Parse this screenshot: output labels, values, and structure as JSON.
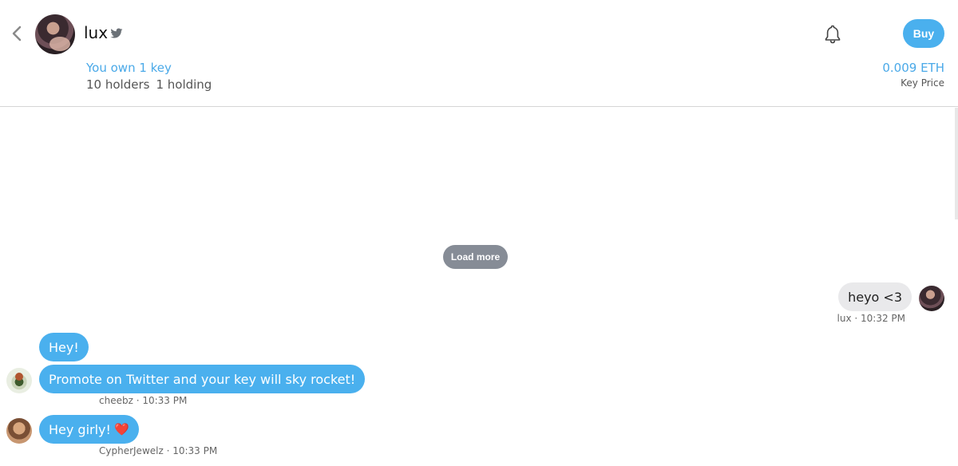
{
  "header": {
    "user_name": "lux",
    "own_key_text": "You own 1 key",
    "holders_text": "10 holders",
    "holding_text": "1 holding",
    "buy_label": "Buy",
    "price_value": "0.009 ETH",
    "price_label": "Key Price",
    "icons": [
      "back-chevron-icon",
      "twitter-bird-icon",
      "bell-icon"
    ]
  },
  "chat": {
    "load_more_label": "Load more",
    "messages": [
      {
        "text": "heyo <3",
        "direction": "outgoing",
        "meta": "lux · 10:32 PM"
      },
      {
        "text": "Hey!",
        "direction": "incoming"
      },
      {
        "text": "Promote on Twitter and your key will sky rocket!",
        "direction": "incoming",
        "meta": "cheebz · 10:33 PM"
      },
      {
        "text": "Hey girly!",
        "emoji": "❤️",
        "direction": "incoming",
        "meta": "CypherJewelz · 10:33 PM"
      }
    ]
  },
  "colors": {
    "accent": "#4ab0ee",
    "outgoing_bubble": "#e9e9eb",
    "load_more_bg": "#868c96"
  }
}
